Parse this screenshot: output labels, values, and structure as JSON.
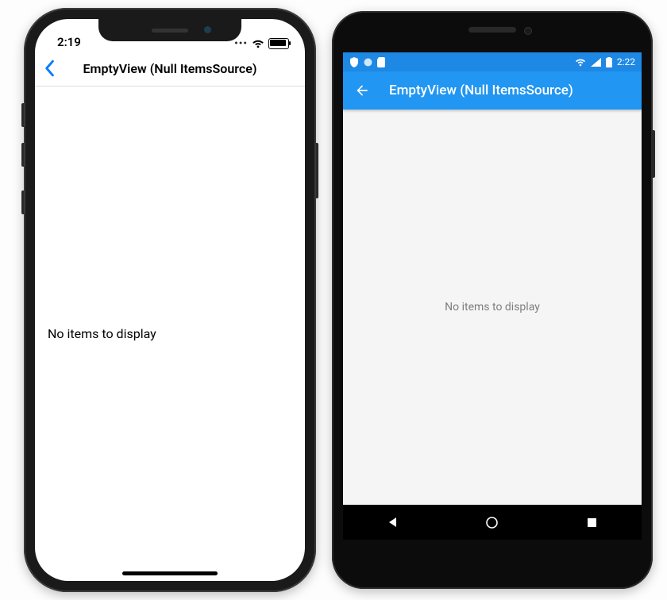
{
  "ios": {
    "status": {
      "time": "2:19",
      "signal_glyph": "•••",
      "wifi_icon": "wifi",
      "battery_icon": "battery"
    },
    "nav": {
      "back_icon": "chevron-left",
      "title": "EmptyView (Null ItemsSource)"
    },
    "content": {
      "empty_text": "No items to display"
    },
    "home_indicator": "home-bar"
  },
  "android": {
    "status": {
      "left_icons": [
        "shield",
        "circle",
        "sdcard"
      ],
      "right_icons": [
        "wifi",
        "signal",
        "battery"
      ],
      "time": "2:22"
    },
    "appbar": {
      "back_icon": "arrow-left",
      "title": "EmptyView (Null ItemsSource)"
    },
    "content": {
      "empty_text": "No items to display"
    },
    "navbar": {
      "back_icon": "triangle-left",
      "home_icon": "circle",
      "recent_icon": "square"
    }
  },
  "colors": {
    "ios_accent": "#0a7bff",
    "android_primary": "#2196f3",
    "android_primary_dark": "#1e88e5"
  }
}
